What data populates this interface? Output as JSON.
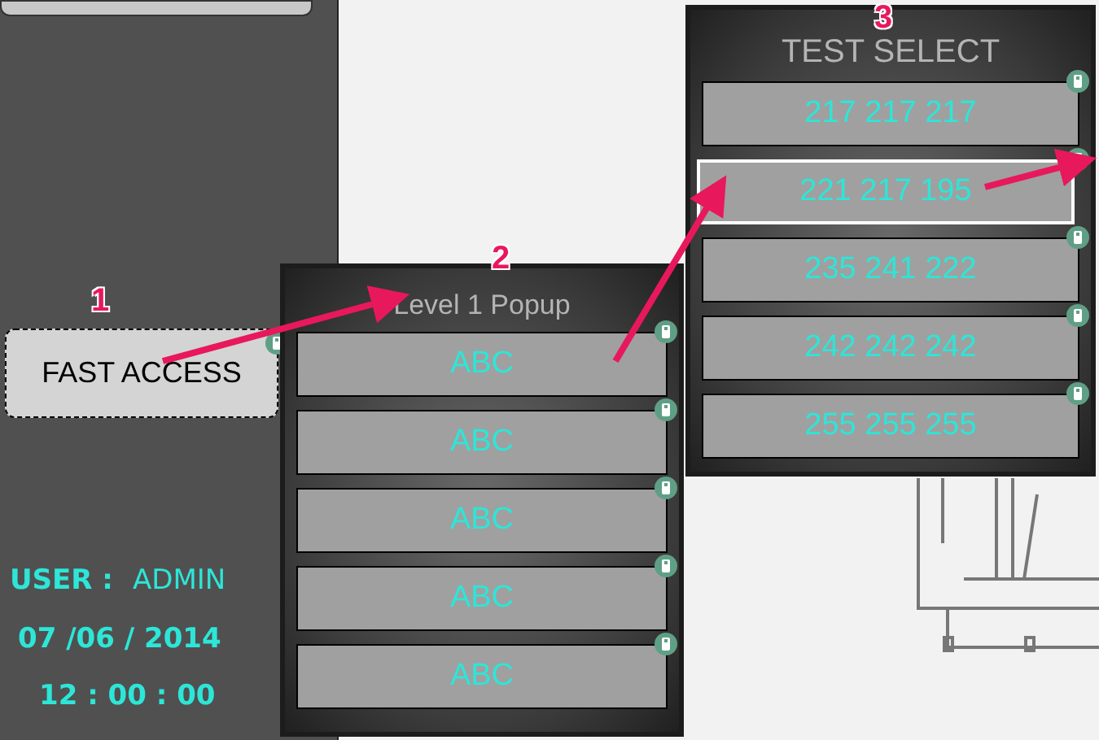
{
  "fast_access": {
    "label": "FAST ACCESS",
    "focused": true
  },
  "status": {
    "user_label": "USER :",
    "user": "ADMIN",
    "date": "07 /06 / 2014",
    "time": "12 : 00 : 00"
  },
  "popup_1": {
    "title": "Level 1 Popup",
    "items": [
      {
        "label": "ABC",
        "selected": false
      },
      {
        "label": "ABC",
        "selected": false
      },
      {
        "label": "ABC",
        "selected": false
      },
      {
        "label": "ABC",
        "selected": false
      },
      {
        "label": "ABC",
        "selected": false
      }
    ]
  },
  "popup_2": {
    "title": "TEST SELECT",
    "items": [
      {
        "label": "217 217 217",
        "selected": false
      },
      {
        "label": "221 217 195",
        "selected": true
      },
      {
        "label": "235 241 222",
        "selected": false
      },
      {
        "label": "242 242 242",
        "selected": false
      },
      {
        "label": "255 255 255",
        "selected": false
      }
    ]
  },
  "annotations": [
    {
      "label": "1"
    },
    {
      "label": "2"
    },
    {
      "label": "3"
    }
  ]
}
